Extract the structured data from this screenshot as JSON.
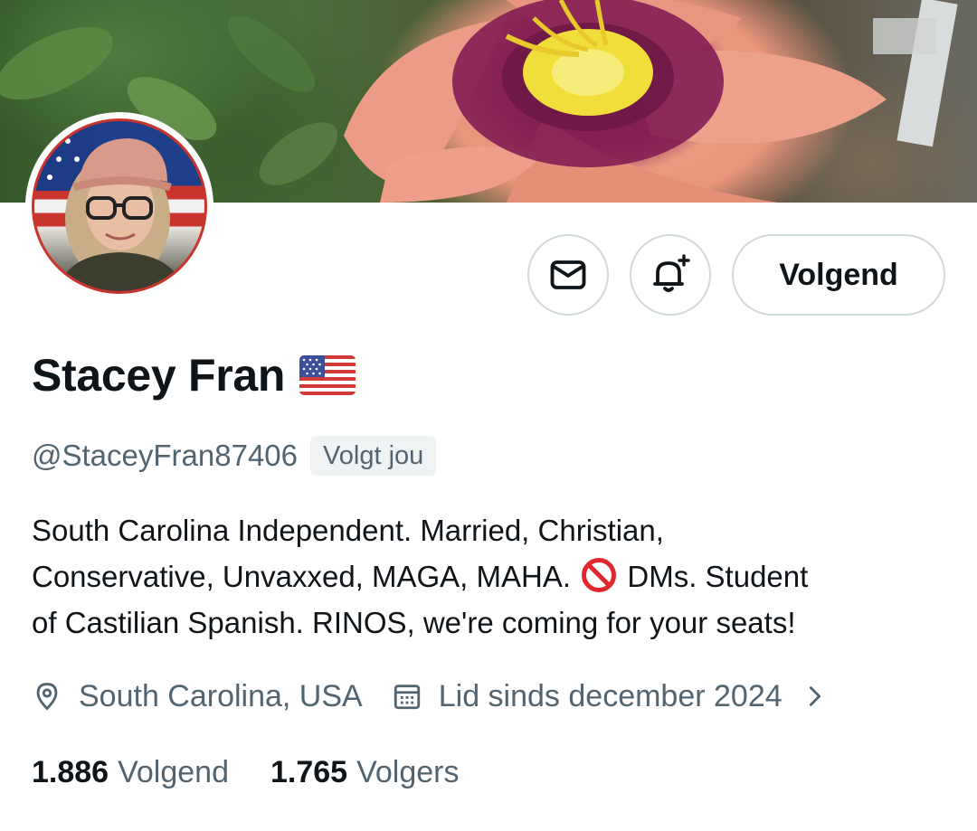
{
  "profile": {
    "display_name": "Stacey Fran",
    "handle": "@StaceyFran87406",
    "follows_you_badge": "Volgt jou",
    "bio": {
      "line1": "South Carolina Independent. Married, Christian,",
      "line2_before_emoji": "Conservative, Unvaxxed, MAGA, MAHA.",
      "line2_after_emoji": "DMs. Student",
      "line3": "of Castilian Spanish. RINOS, we're coming for your seats!"
    },
    "location": "South Carolina, USA",
    "joined": "Lid sinds december 2024",
    "stats": {
      "following_count": "1.886",
      "following_label": "Volgend",
      "followers_count": "1.765",
      "followers_label": "Volgers"
    }
  },
  "actions": {
    "follow_button_label": "Volgend"
  },
  "icons": {
    "message": "envelope-icon",
    "notify": "bell-plus-icon",
    "location": "map-pin-icon",
    "joined": "calendar-icon",
    "more": "chevron-right-icon",
    "name_emoji": "us-flag",
    "bio_emoji": "no-entry-sign"
  },
  "colors": {
    "text_primary": "#0f1419",
    "text_secondary": "#536471",
    "button_border": "#cfd9de",
    "badge_bg": "#eff3f4"
  }
}
